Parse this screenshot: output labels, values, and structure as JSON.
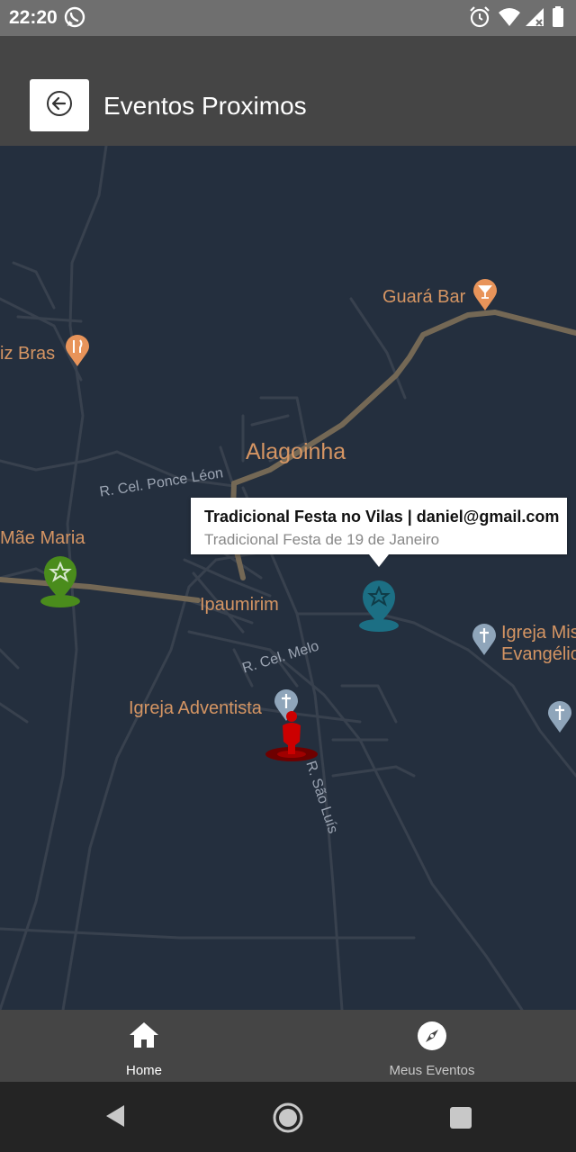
{
  "status_bar": {
    "time": "22:20",
    "icons": [
      "whatsapp-icon",
      "alarm-icon",
      "wifi-icon",
      "signal-icon",
      "battery-icon"
    ]
  },
  "app_bar": {
    "title": "Eventos Proximos",
    "back_icon": "back-arrow-icon"
  },
  "map": {
    "poi_labels": {
      "guara_bar": "Guará Bar",
      "luiz_bras": "iz Bras",
      "mae_maria": "Mãe Maria",
      "igreja_adventista": "Igreja Adventista",
      "igreja_mis_line1": "Igreja Mis",
      "igreja_mis_line2": "Evangélic"
    },
    "town_labels": {
      "alagoinha": "Alagoinha",
      "ipaumirim": "Ipaumirim"
    },
    "street_labels": {
      "ponce_leon": "R. Cel. Ponce Léon",
      "cel_melo": "R. Cel. Melo",
      "sao_luis": "R. São Luís"
    },
    "info_window": {
      "title": "Tradicional Festa no Vilas | daniel@gmail.com",
      "snippet": "Tradicional Festa de 19 de Janeiro"
    },
    "marker_colors": {
      "event_green": "#4a8c1c",
      "event_teal": "#1c6f84",
      "user_location": "#cc0000",
      "poi_orange": "#e8945a",
      "poi_church": "#8fa5ba"
    }
  },
  "bottom_nav": {
    "home": {
      "label": "Home",
      "icon": "home-icon",
      "active": true
    },
    "meus_eventos": {
      "label": "Meus Eventos",
      "icon": "compass-icon",
      "active": false
    }
  },
  "system_nav": [
    "back-triangle-icon",
    "home-circle-icon",
    "recents-square-icon"
  ]
}
